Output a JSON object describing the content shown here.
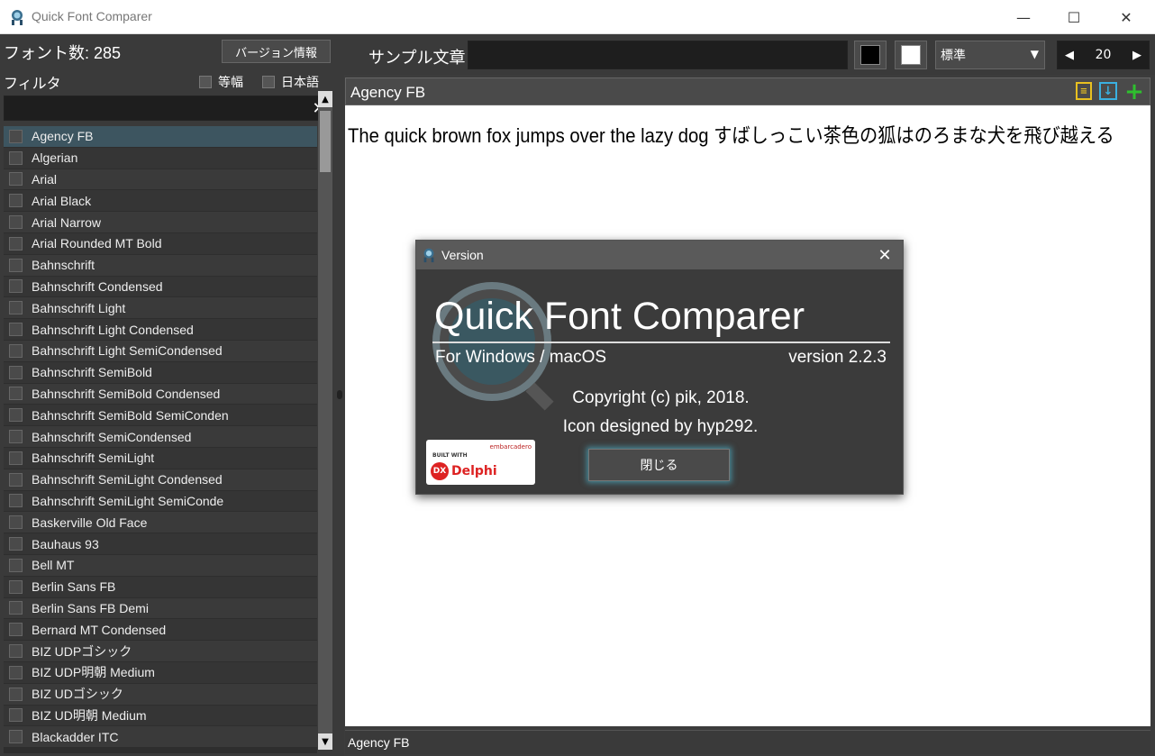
{
  "window": {
    "title": "Quick Font Comparer",
    "minimize": "—",
    "maximize": "☐",
    "close": "✕"
  },
  "left_panel": {
    "font_count": "フォント数: 285",
    "version_button": "バージョン情報",
    "filter_label": "フィルタ",
    "filter_options": [
      {
        "label": "等幅",
        "checked": false
      },
      {
        "label": "日本語",
        "checked": false
      }
    ],
    "filter_value": "",
    "filter_clear": "✕",
    "fonts": [
      {
        "name": "Agency FB",
        "selected": true
      },
      {
        "name": "Algerian"
      },
      {
        "name": "Arial"
      },
      {
        "name": "Arial Black"
      },
      {
        "name": "Arial Narrow"
      },
      {
        "name": "Arial Rounded MT Bold"
      },
      {
        "name": "Bahnschrift"
      },
      {
        "name": "Bahnschrift Condensed"
      },
      {
        "name": "Bahnschrift Light"
      },
      {
        "name": "Bahnschrift Light Condensed"
      },
      {
        "name": "Bahnschrift Light SemiCondensed"
      },
      {
        "name": "Bahnschrift SemiBold"
      },
      {
        "name": "Bahnschrift SemiBold Condensed"
      },
      {
        "name": "Bahnschrift SemiBold SemiConden"
      },
      {
        "name": "Bahnschrift SemiCondensed"
      },
      {
        "name": "Bahnschrift SemiLight"
      },
      {
        "name": "Bahnschrift SemiLight Condensed"
      },
      {
        "name": "Bahnschrift SemiLight SemiConde"
      },
      {
        "name": "Baskerville Old Face"
      },
      {
        "name": "Bauhaus 93"
      },
      {
        "name": "Bell MT"
      },
      {
        "name": "Berlin Sans FB"
      },
      {
        "name": "Berlin Sans FB Demi"
      },
      {
        "name": "Bernard MT Condensed"
      },
      {
        "name": "BIZ UDPゴシック"
      },
      {
        "name": "BIZ UDP明朝 Medium"
      },
      {
        "name": "BIZ UDゴシック"
      },
      {
        "name": "BIZ UD明朝 Medium"
      },
      {
        "name": "Blackadder ITC"
      }
    ]
  },
  "toolbar": {
    "sample_label": "サンプル文章",
    "sample_value": "",
    "fg_color": "#000000",
    "bg_color": "#ffffff",
    "style_value": "標準",
    "size_value": "20",
    "size_decrease": "◀",
    "size_increase": "▶"
  },
  "preview": {
    "font_name": "Agency FB",
    "sample_text": "The quick brown fox jumps over the lazy dog すばしっこい茶色の狐はのろまな犬を飛び越える",
    "status_font": "Agency FB"
  },
  "dialog": {
    "title": "Version",
    "app_name": "Quick Font Comparer",
    "platform": "For Windows / macOS",
    "version": "version 2.2.3",
    "copyright": "Copyright (c) pik, 2018.",
    "icon_credit": "Icon designed by hyp292.",
    "ok_button": "閉じる",
    "delphi_built": "BUILT WITH",
    "delphi_brand": "embarcadero",
    "delphi_dx": "DX",
    "delphi_name": "Delphi"
  }
}
